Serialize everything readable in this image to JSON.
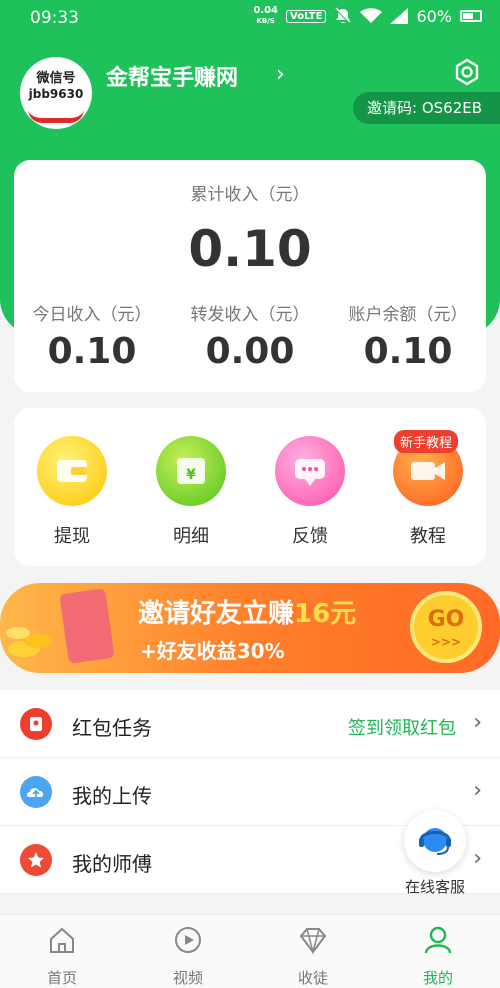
{
  "statusbar": {
    "time": "09:33",
    "net_speed_value": "0.04",
    "net_speed_unit": "KB/S",
    "volte": "VoLTE",
    "battery": "60%"
  },
  "profile": {
    "avatar_line1": "微信号",
    "avatar_line2": "jbb9630",
    "name": "金帮宝手赚网",
    "invite_code": "邀请码: OS62EB"
  },
  "income": {
    "total_label": "累计收入（元）",
    "total_value": "0.10",
    "today_label": "今日收入（元）",
    "today_value": "0.10",
    "forward_label": "转发收入（元）",
    "forward_value": "0.00",
    "balance_label": "账户余额（元）",
    "balance_value": "0.10"
  },
  "actions": {
    "withdraw": "提现",
    "details": "明细",
    "feedback": "反馈",
    "tutorial": "教程",
    "new_badge": "新手教程",
    "details_symbol": "¥"
  },
  "banner": {
    "title_prefix": "邀请好友立赚",
    "title_amount": "16元",
    "subtitle": "+好友收益30%",
    "go": "GO",
    "go_arrows": ">>>"
  },
  "list": {
    "red_packet": "红包任务",
    "red_packet_extra": "签到领取红包",
    "uploads": "我的上传",
    "master": "我的师傅"
  },
  "customer_service": "在线客服",
  "tabs": {
    "home": "首页",
    "video": "视频",
    "apprentice": "收徒",
    "mine": "我的"
  },
  "colors": {
    "brand_green": "#1fc25a",
    "accent_orange": "#ff7f2b",
    "red": "#ee3f2e"
  }
}
